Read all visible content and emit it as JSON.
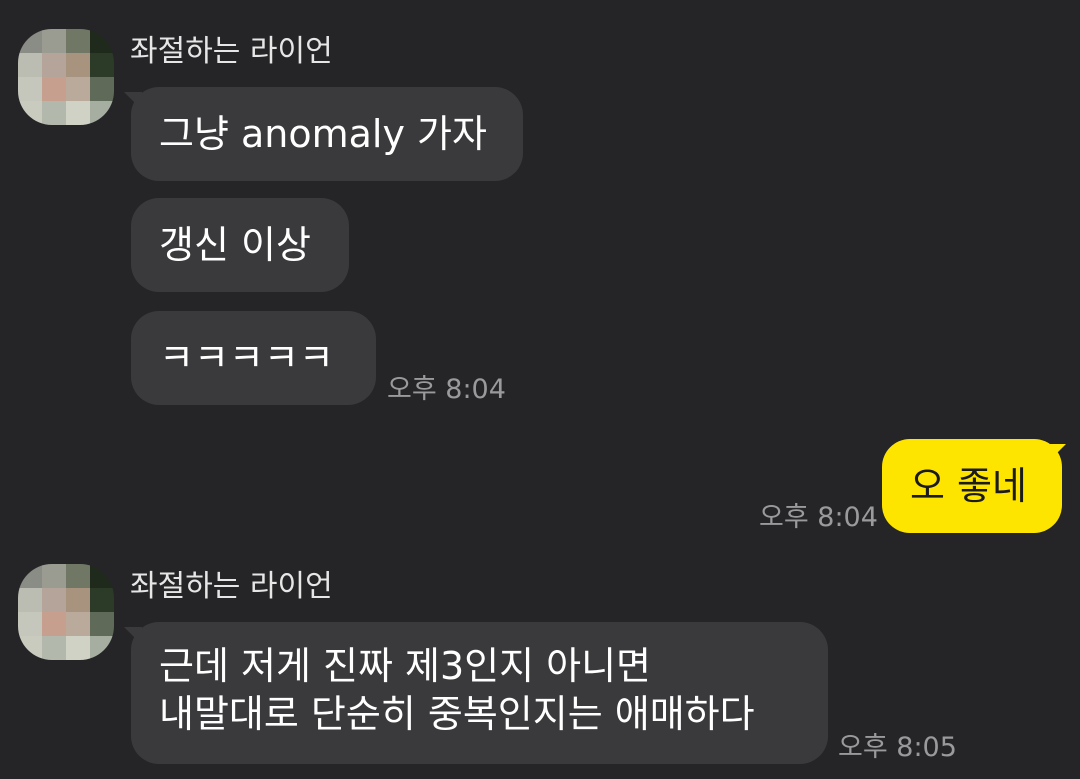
{
  "chat": {
    "groups": [
      {
        "sender": "좌절하는 라이언",
        "messages": [
          "그냥 anomaly 가자",
          "갱신 이상",
          "ㅋㅋㅋㅋㅋ"
        ],
        "time": "오후 8:04"
      },
      {
        "mine": true,
        "messages": [
          "오 좋네"
        ],
        "time": "오후 8:04"
      },
      {
        "sender": "좌절하는 라이언",
        "messages": [
          "근데 저게 진짜 제3인지 아니면\n내말대로 단순히 중복인지는 애매하다"
        ],
        "time": "오후 8:05"
      }
    ]
  },
  "theme": {
    "background": "#252527",
    "incoming_bubble": "#3a3a3c",
    "outgoing_bubble": "#fee500",
    "timestamp": "#9a9a9c"
  },
  "icons": {
    "avatar": "pixelated-profile-avatar"
  }
}
